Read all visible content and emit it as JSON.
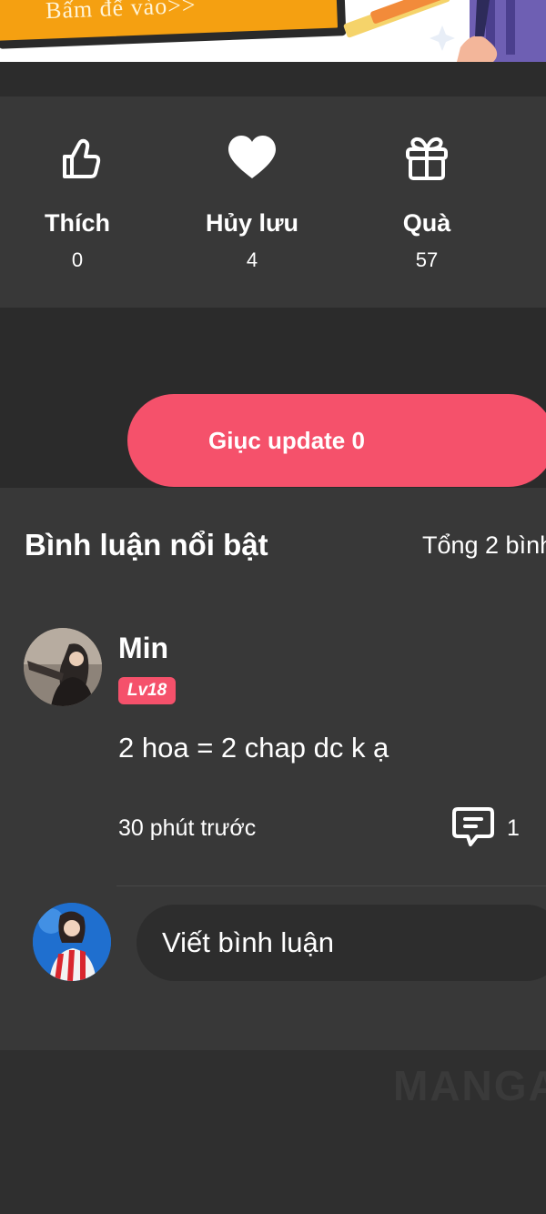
{
  "banner": {
    "text": "Bấm để vào>>"
  },
  "stats": [
    {
      "label": "Thích",
      "value": "0",
      "icon": "thumbs-up-icon"
    },
    {
      "label": "Hủy lưu",
      "value": "4",
      "icon": "heart-icon"
    },
    {
      "label": "Quà",
      "value": "57",
      "icon": "gift-icon"
    }
  ],
  "update_button": {
    "label": "Giục update 0"
  },
  "comments": {
    "title": "Bình luận nổi bật",
    "total": "Tổng 2 bình",
    "items": [
      {
        "user": "Min",
        "level": "Lv18",
        "text": "2 hoa = 2 chap dc k ạ",
        "time": "30 phút trước",
        "reply_count": "1"
      }
    ],
    "compose_placeholder": "Viết bình luận"
  },
  "watermark": "MANGA",
  "colors": {
    "accent": "#f5516b",
    "panel": "#383838",
    "background": "#2f2f2f",
    "banner_orange": "#f5a011"
  }
}
